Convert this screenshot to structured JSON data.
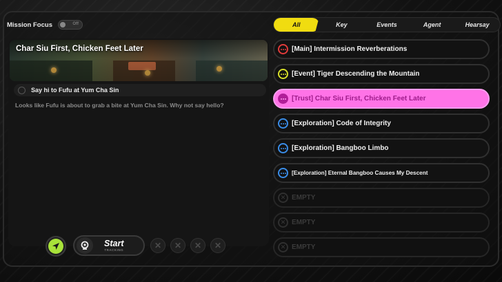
{
  "header": {
    "mission_focus_label": "Mission Focus",
    "toggle_state": "Off"
  },
  "tabs": [
    {
      "label": "All",
      "active": true
    },
    {
      "label": "Key",
      "active": false
    },
    {
      "label": "Events",
      "active": false
    },
    {
      "label": "Agent",
      "active": false
    },
    {
      "label": "Hearsay",
      "active": false
    }
  ],
  "detail": {
    "title": "Char Siu First, Chicken Feet Later",
    "objective": "Say hi to Fufu at Yum Cha Sin",
    "description": "Looks like Fufu is about to grab a bite at Yum Cha Sin. Why not say hello?"
  },
  "controls": {
    "start_label": "Start",
    "tracking_label": "TRACKING",
    "slot_icon": "close-icon"
  },
  "quests": [
    {
      "label": "[Main] Intermission Reverberations",
      "type": "main",
      "color": "#e23b3b"
    },
    {
      "label": "[Event] Tiger Descending the Mountain",
      "type": "event",
      "color": "#d8e02a"
    },
    {
      "label": "[Trust] Char Siu First, Chicken Feet Later",
      "type": "trust",
      "color": "#b01e98",
      "active": true
    },
    {
      "label": "[Exploration] Code of Integrity",
      "type": "exploration",
      "color": "#3a8de8"
    },
    {
      "label": "[Exploration] Bangboo Limbo",
      "type": "exploration",
      "color": "#3a8de8"
    },
    {
      "label": "[Exploration] Eternal Bangboo Causes My Descent",
      "type": "exploration",
      "color": "#3a8de8"
    },
    {
      "label": "EMPTY",
      "type": "empty"
    },
    {
      "label": "EMPTY",
      "type": "empty"
    },
    {
      "label": "EMPTY",
      "type": "empty"
    }
  ],
  "colors": {
    "tab_active": "#f0dc10",
    "quest_active": "#ff73e7",
    "nav_button": "#a8e23a"
  }
}
